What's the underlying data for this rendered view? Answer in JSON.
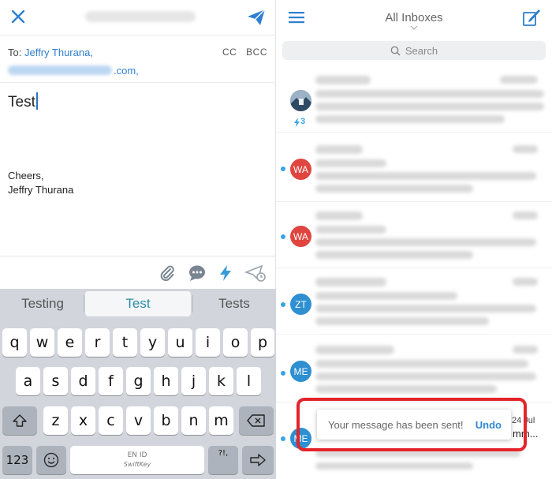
{
  "compose": {
    "to_label": "To:",
    "to_name": "Jeffry Thurana,",
    "to_address_suffix": ".com,",
    "cc_label": "CC",
    "bcc_label": "BCC",
    "subject": "Test",
    "signature_line1": "Cheers,",
    "signature_line2": "Jeffry Thurana"
  },
  "keyboard": {
    "suggestions": [
      "Testing",
      "Test",
      "Tests"
    ],
    "row1": [
      "q",
      "w",
      "e",
      "r",
      "t",
      "y",
      "u",
      "i",
      "o",
      "p"
    ],
    "row2": [
      "a",
      "s",
      "d",
      "f",
      "g",
      "h",
      "j",
      "k",
      "l"
    ],
    "row3": [
      "z",
      "x",
      "c",
      "v",
      "b",
      "n",
      "m"
    ],
    "numbers_key": "123",
    "space_label": "EN ID",
    "space_brand": "SwiftKey",
    "punct_key": "?!,"
  },
  "inbox": {
    "title": "All Inboxes",
    "search_placeholder": "Search",
    "thread_count": "3",
    "avatars": [
      "WA",
      "WA",
      "ZT",
      "ME",
      "ME"
    ],
    "avatar_colors": [
      "#e0453f",
      "#e0453f",
      "#2e8fd1",
      "#2e8fd1",
      "#2e8fd1"
    ],
    "peek_date": "24 Jul",
    "peek_subject": "mm..."
  },
  "toast": {
    "message": "Your message has been sent!",
    "undo_label": "Undo"
  },
  "colors": {
    "accent": "#2f7fd0",
    "highlight": "#e3242b"
  }
}
